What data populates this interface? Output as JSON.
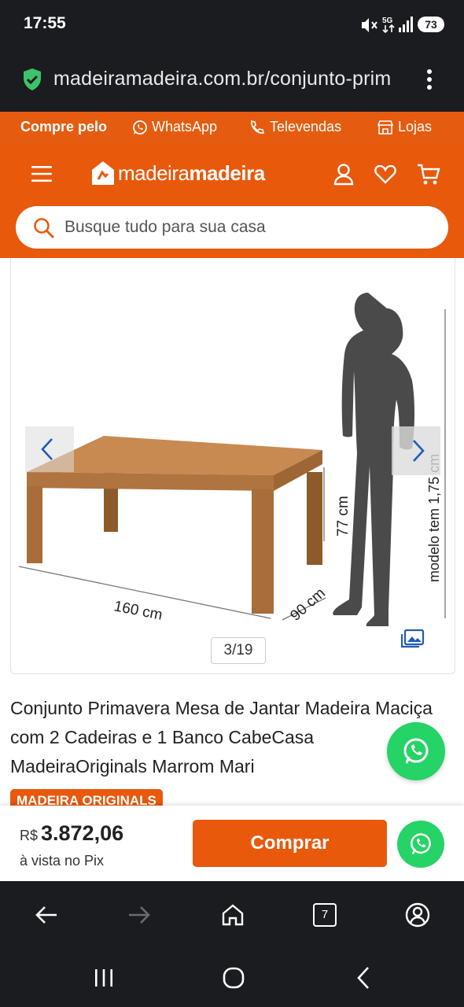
{
  "status_bar": {
    "time": "17:55",
    "battery": "73"
  },
  "browser": {
    "url": "madeiramadeira.com.br/conjunto-prim",
    "tab_count": "7"
  },
  "promo": {
    "prefix": "Compre pelo",
    "whatsapp": "WhatsApp",
    "televendas": "Televendas",
    "lojas": "Lojas"
  },
  "header": {
    "logo_light": "madeira",
    "logo_bold": "madeira"
  },
  "search": {
    "placeholder": "Busque tudo para sua casa"
  },
  "gallery": {
    "counter": "3/19",
    "dim_width": "160 cm",
    "dim_depth": "90 cm",
    "dim_height": "77 cm",
    "model_height": "modelo tem 1,75 cm"
  },
  "product": {
    "title": "Conjunto Primavera Mesa de Jantar Madeira Maciça com 2 Cadeiras e 1 Banco CabeCasa MadeiraOriginals Marrom Mari",
    "badge": "MADEIRA ORIGINALS"
  },
  "buy_bar": {
    "currency": "R$",
    "price": "3.872,06",
    "payment_note": "à vista no Pix",
    "buy_label": "Comprar"
  },
  "colors": {
    "brand_orange": "#e8590c",
    "whatsapp_green": "#25d366",
    "dark": "#1b1c20"
  }
}
